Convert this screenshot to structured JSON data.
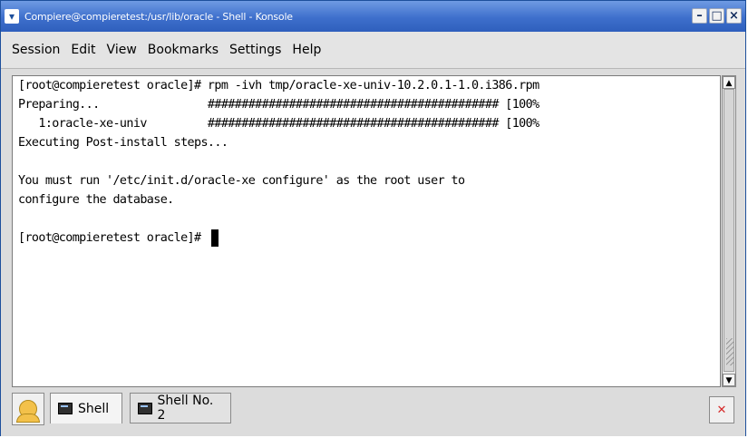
{
  "window": {
    "title": "Compiere@compieretest:/usr/lib/oracle - Shell - Konsole",
    "buttons": [
      "minimize-icon",
      "maximize-icon",
      "close-icon"
    ]
  },
  "menubar": {
    "items": [
      "Session",
      "Edit",
      "View",
      "Bookmarks",
      "Settings",
      "Help"
    ]
  },
  "terminal": {
    "lines": [
      "[root@compieretest oracle]# rpm -ivh tmp/oracle-xe-univ-10.2.0.1-1.0.i386.rpm",
      "Preparing...                ########################################### [100%",
      "   1:oracle-xe-univ         ########################################### [100%",
      "Executing Post-install steps...",
      "",
      "You must run '/etc/init.d/oracle-xe configure' as the root user to",
      "configure the database.",
      "",
      "[root@compieretest oracle]# "
    ]
  },
  "tabs": [
    {
      "label": "Shell"
    },
    {
      "label": "Shell No. 2"
    }
  ],
  "icons": {
    "new_session": "new-session-icon",
    "tab": "terminal-icon",
    "close_session": "close-session-icon"
  }
}
